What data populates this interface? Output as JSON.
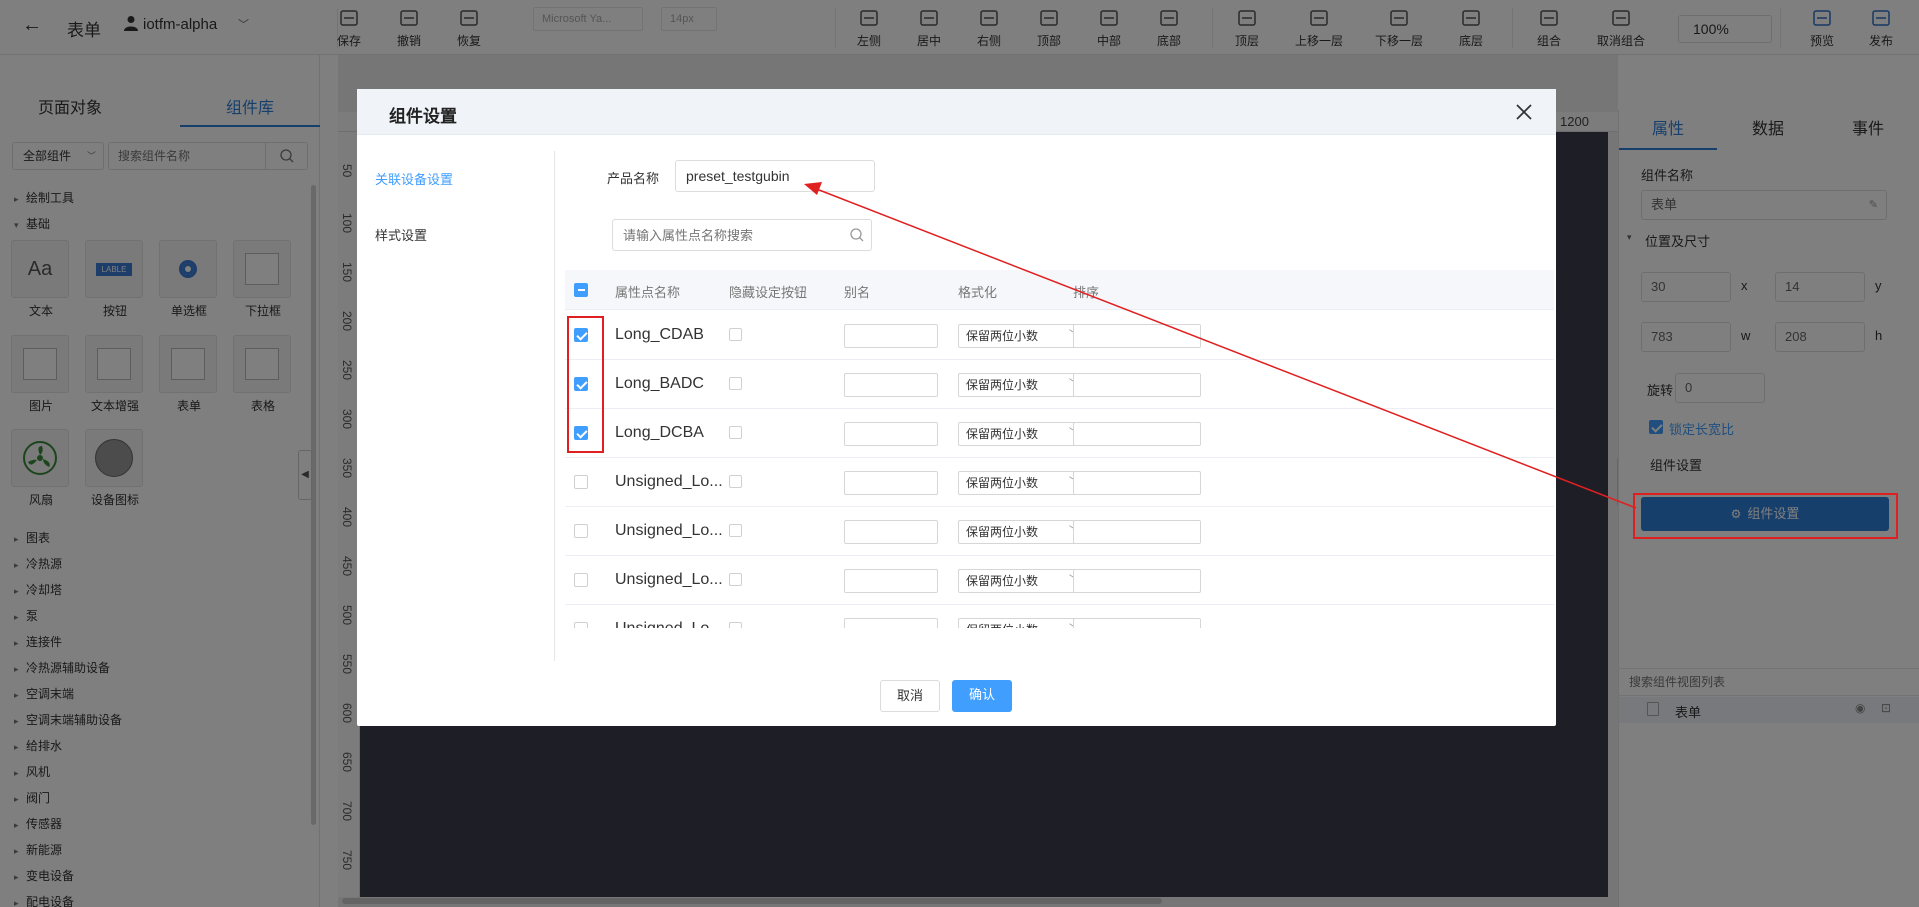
{
  "header": {
    "back_label": "←",
    "doc_title": "表单",
    "user_name": "iotfm-alpha",
    "add_label": "+",
    "font_family": "Microsoft Ya...",
    "font_size": "14px",
    "zoom": "100%"
  },
  "toolbar": [
    {
      "label": "保存",
      "icon": "save-icon"
    },
    {
      "label": "撤销",
      "icon": "undo-icon"
    },
    {
      "label": "恢复",
      "icon": "redo-icon"
    },
    {
      "label": "左侧",
      "icon": "align-left-icon"
    },
    {
      "label": "居中",
      "icon": "align-center-icon"
    },
    {
      "label": "右侧",
      "icon": "align-right-icon"
    },
    {
      "label": "顶部",
      "icon": "align-top-icon"
    },
    {
      "label": "中部",
      "icon": "align-middle-icon"
    },
    {
      "label": "底部",
      "icon": "align-bottom-icon"
    },
    {
      "label": "顶层",
      "icon": "bring-front-icon"
    },
    {
      "label": "上移一层",
      "icon": "move-up-icon"
    },
    {
      "label": "下移一层",
      "icon": "move-down-icon"
    },
    {
      "label": "底层",
      "icon": "send-back-icon"
    },
    {
      "label": "组合",
      "icon": "group-icon"
    },
    {
      "label": "取消组合",
      "icon": "ungroup-icon"
    },
    {
      "label": "预览",
      "icon": "preview-icon"
    },
    {
      "label": "发布",
      "icon": "publish-icon"
    }
  ],
  "left_panel": {
    "tabs": [
      "页面对象",
      "组件库"
    ],
    "filter": "全部组件",
    "search_placeholder": "搜索组件名称",
    "group_draw": "绘制工具",
    "group_basic": "基础",
    "components": [
      "文本",
      "按钮",
      "单选框",
      "下拉框",
      "图片",
      "文本增强",
      "表单",
      "表格",
      "风扇",
      "设备图标"
    ],
    "button_preview": "LABLE",
    "tree": [
      "图表",
      "冷热源",
      "冷却塔",
      "泵",
      "连接件",
      "冷热源辅助设备",
      "空调末端",
      "空调末端辅助设备",
      "给排水",
      "风机",
      "阀门",
      "传感器",
      "新能源",
      "变电设备",
      "配电设备"
    ]
  },
  "ruler": {
    "top": "1200",
    "left": [
      "50",
      "100",
      "150",
      "200",
      "250",
      "300",
      "350",
      "400",
      "450",
      "500",
      "550",
      "600",
      "650",
      "700",
      "750"
    ]
  },
  "right_panel": {
    "tabs": [
      "属性",
      "数据",
      "事件"
    ],
    "comp_name_label": "组件名称",
    "comp_name_value": "表单",
    "pos_size_label": "位置及尺寸",
    "x": "30",
    "x_label": "x",
    "y": "14",
    "y_label": "y",
    "w": "783",
    "w_label": "w",
    "h": "208",
    "h_label": "h",
    "rotate_label": "旋转",
    "rotate_value": "0",
    "lock_ratio": "锁定长宽比",
    "comp_settings_label": "组件设置",
    "comp_settings_button": "组件设置",
    "view_search_placeholder": "搜索组件视图列表",
    "view_item": "表单"
  },
  "modal": {
    "title": "组件设置",
    "nav": [
      "关联设备设置",
      "样式设置"
    ],
    "product_label": "产品名称",
    "product_value": "preset_testgubin",
    "search_placeholder": "请输入属性点名称搜索",
    "columns": [
      "属性点名称",
      "隐藏设定按钮",
      "别名",
      "格式化",
      "排序"
    ],
    "rows": [
      {
        "name": "Long_CDAB",
        "checked": true,
        "format": "保留两位小数"
      },
      {
        "name": "Long_BADC",
        "checked": true,
        "format": "保留两位小数"
      },
      {
        "name": "Long_DCBA",
        "checked": true,
        "format": "保留两位小数"
      },
      {
        "name": "Unsigned_Lo...",
        "checked": false,
        "format": "保留两位小数"
      },
      {
        "name": "Unsigned_Lo...",
        "checked": false,
        "format": "保留两位小数"
      },
      {
        "name": "Unsigned_Lo...",
        "checked": false,
        "format": "保留两位小数"
      },
      {
        "name": "Unsigned_Lo...",
        "checked": false,
        "format": "保留两位小数"
      }
    ],
    "cancel": "取消",
    "confirm": "确认"
  },
  "colors": {
    "accent": "#409eff",
    "annotation": "#e02020",
    "canvas": "#3b3d4d"
  }
}
